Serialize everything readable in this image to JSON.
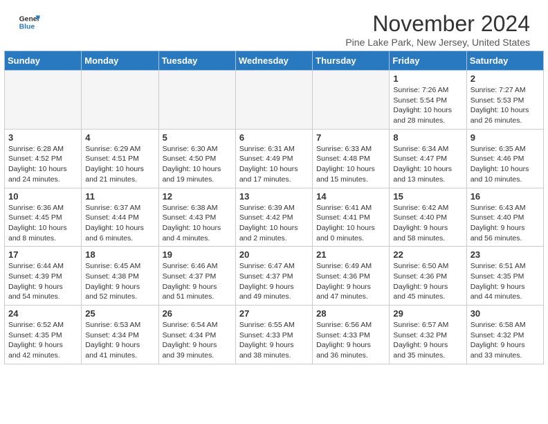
{
  "header": {
    "logo_line1": "General",
    "logo_line2": "Blue",
    "month": "November 2024",
    "location": "Pine Lake Park, New Jersey, United States"
  },
  "weekdays": [
    "Sunday",
    "Monday",
    "Tuesday",
    "Wednesday",
    "Thursday",
    "Friday",
    "Saturday"
  ],
  "weeks": [
    [
      {
        "day": "",
        "info": ""
      },
      {
        "day": "",
        "info": ""
      },
      {
        "day": "",
        "info": ""
      },
      {
        "day": "",
        "info": ""
      },
      {
        "day": "",
        "info": ""
      },
      {
        "day": "1",
        "info": "Sunrise: 7:26 AM\nSunset: 5:54 PM\nDaylight: 10 hours\nand 28 minutes."
      },
      {
        "day": "2",
        "info": "Sunrise: 7:27 AM\nSunset: 5:53 PM\nDaylight: 10 hours\nand 26 minutes."
      }
    ],
    [
      {
        "day": "3",
        "info": "Sunrise: 6:28 AM\nSunset: 4:52 PM\nDaylight: 10 hours\nand 24 minutes."
      },
      {
        "day": "4",
        "info": "Sunrise: 6:29 AM\nSunset: 4:51 PM\nDaylight: 10 hours\nand 21 minutes."
      },
      {
        "day": "5",
        "info": "Sunrise: 6:30 AM\nSunset: 4:50 PM\nDaylight: 10 hours\nand 19 minutes."
      },
      {
        "day": "6",
        "info": "Sunrise: 6:31 AM\nSunset: 4:49 PM\nDaylight: 10 hours\nand 17 minutes."
      },
      {
        "day": "7",
        "info": "Sunrise: 6:33 AM\nSunset: 4:48 PM\nDaylight: 10 hours\nand 15 minutes."
      },
      {
        "day": "8",
        "info": "Sunrise: 6:34 AM\nSunset: 4:47 PM\nDaylight: 10 hours\nand 13 minutes."
      },
      {
        "day": "9",
        "info": "Sunrise: 6:35 AM\nSunset: 4:46 PM\nDaylight: 10 hours\nand 10 minutes."
      }
    ],
    [
      {
        "day": "10",
        "info": "Sunrise: 6:36 AM\nSunset: 4:45 PM\nDaylight: 10 hours\nand 8 minutes."
      },
      {
        "day": "11",
        "info": "Sunrise: 6:37 AM\nSunset: 4:44 PM\nDaylight: 10 hours\nand 6 minutes."
      },
      {
        "day": "12",
        "info": "Sunrise: 6:38 AM\nSunset: 4:43 PM\nDaylight: 10 hours\nand 4 minutes."
      },
      {
        "day": "13",
        "info": "Sunrise: 6:39 AM\nSunset: 4:42 PM\nDaylight: 10 hours\nand 2 minutes."
      },
      {
        "day": "14",
        "info": "Sunrise: 6:41 AM\nSunset: 4:41 PM\nDaylight: 10 hours\nand 0 minutes."
      },
      {
        "day": "15",
        "info": "Sunrise: 6:42 AM\nSunset: 4:40 PM\nDaylight: 9 hours\nand 58 minutes."
      },
      {
        "day": "16",
        "info": "Sunrise: 6:43 AM\nSunset: 4:40 PM\nDaylight: 9 hours\nand 56 minutes."
      }
    ],
    [
      {
        "day": "17",
        "info": "Sunrise: 6:44 AM\nSunset: 4:39 PM\nDaylight: 9 hours\nand 54 minutes."
      },
      {
        "day": "18",
        "info": "Sunrise: 6:45 AM\nSunset: 4:38 PM\nDaylight: 9 hours\nand 52 minutes."
      },
      {
        "day": "19",
        "info": "Sunrise: 6:46 AM\nSunset: 4:37 PM\nDaylight: 9 hours\nand 51 minutes."
      },
      {
        "day": "20",
        "info": "Sunrise: 6:47 AM\nSunset: 4:37 PM\nDaylight: 9 hours\nand 49 minutes."
      },
      {
        "day": "21",
        "info": "Sunrise: 6:49 AM\nSunset: 4:36 PM\nDaylight: 9 hours\nand 47 minutes."
      },
      {
        "day": "22",
        "info": "Sunrise: 6:50 AM\nSunset: 4:36 PM\nDaylight: 9 hours\nand 45 minutes."
      },
      {
        "day": "23",
        "info": "Sunrise: 6:51 AM\nSunset: 4:35 PM\nDaylight: 9 hours\nand 44 minutes."
      }
    ],
    [
      {
        "day": "24",
        "info": "Sunrise: 6:52 AM\nSunset: 4:35 PM\nDaylight: 9 hours\nand 42 minutes."
      },
      {
        "day": "25",
        "info": "Sunrise: 6:53 AM\nSunset: 4:34 PM\nDaylight: 9 hours\nand 41 minutes."
      },
      {
        "day": "26",
        "info": "Sunrise: 6:54 AM\nSunset: 4:34 PM\nDaylight: 9 hours\nand 39 minutes."
      },
      {
        "day": "27",
        "info": "Sunrise: 6:55 AM\nSunset: 4:33 PM\nDaylight: 9 hours\nand 38 minutes."
      },
      {
        "day": "28",
        "info": "Sunrise: 6:56 AM\nSunset: 4:33 PM\nDaylight: 9 hours\nand 36 minutes."
      },
      {
        "day": "29",
        "info": "Sunrise: 6:57 AM\nSunset: 4:32 PM\nDaylight: 9 hours\nand 35 minutes."
      },
      {
        "day": "30",
        "info": "Sunrise: 6:58 AM\nSunset: 4:32 PM\nDaylight: 9 hours\nand 33 minutes."
      }
    ]
  ]
}
